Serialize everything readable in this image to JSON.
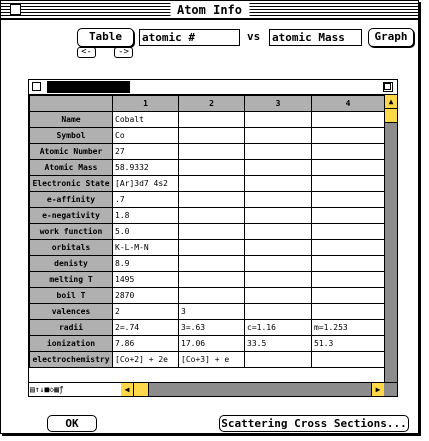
{
  "window": {
    "title": "Atom Info"
  },
  "controls": {
    "table_label": "Table",
    "x_field_value": "atomic #",
    "vs_label": "vs",
    "y_field_value": "atomic Mass",
    "graph_label": "Graph",
    "prev_arrow": "<-",
    "next_arrow": "->"
  },
  "sheet": {
    "columns": [
      "1",
      "2",
      "3",
      "4"
    ],
    "rows": [
      {
        "label": "Name",
        "cells": [
          "Cobalt",
          "",
          "",
          ""
        ]
      },
      {
        "label": "Symbol",
        "cells": [
          "Co",
          "",
          "",
          ""
        ]
      },
      {
        "label": "Atomic Number",
        "cells": [
          "27",
          "",
          "",
          ""
        ]
      },
      {
        "label": "Atomic Mass",
        "cells": [
          "58.9332",
          "",
          "",
          ""
        ]
      },
      {
        "label": "Electronic State",
        "cells": [
          "[Ar]3d7 4s2",
          "",
          "",
          ""
        ]
      },
      {
        "label": "e-affinity",
        "cells": [
          ".7",
          "",
          "",
          ""
        ]
      },
      {
        "label": "e-negativity",
        "cells": [
          "1.8",
          "",
          "",
          ""
        ]
      },
      {
        "label": "work function",
        "cells": [
          "5.0",
          "",
          "",
          ""
        ]
      },
      {
        "label": "orbitals",
        "cells": [
          "K-L-M-N",
          "",
          "",
          ""
        ]
      },
      {
        "label": "denisty",
        "cells": [
          "8.9",
          "",
          "",
          ""
        ]
      },
      {
        "label": "melting T",
        "cells": [
          "1495",
          "",
          "",
          ""
        ]
      },
      {
        "label": "boil T",
        "cells": [
          "2870",
          "",
          "",
          ""
        ]
      },
      {
        "label": "valences",
        "cells": [
          "2",
          "3",
          "",
          ""
        ]
      },
      {
        "label": "radii",
        "cells": [
          "2=.74",
          "3=.63",
          "c=1.16",
          "m=1.253"
        ]
      },
      {
        "label": "ionization",
        "cells": [
          "7.86",
          "17.06",
          "33.5",
          "51.3"
        ]
      },
      {
        "label": "electrochemistry",
        "cells": [
          "[Co+2] + 2e",
          "[Co+3] + e",
          "",
          ""
        ]
      }
    ]
  },
  "buttons": {
    "ok_label": "OK",
    "scattering_label": "Scattering Cross Sections..."
  }
}
